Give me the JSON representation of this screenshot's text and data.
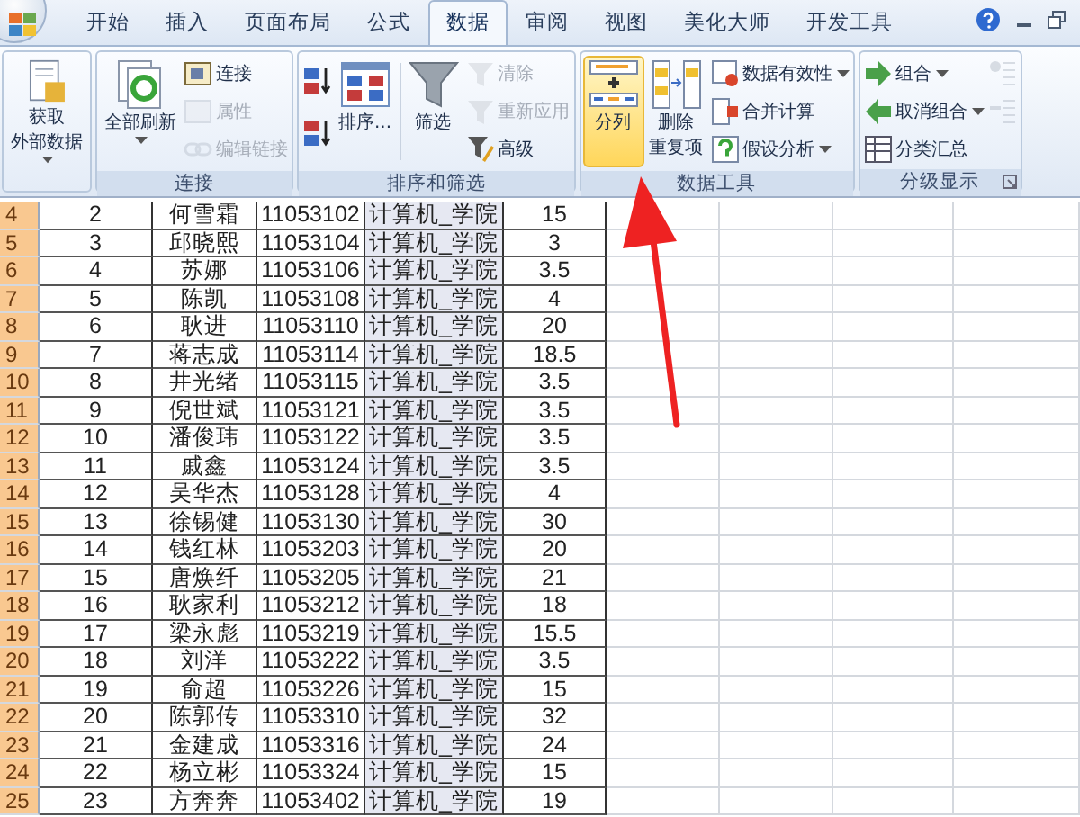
{
  "tabs": [
    {
      "label": "开始",
      "selected": false
    },
    {
      "label": "插入",
      "selected": false
    },
    {
      "label": "页面布局",
      "selected": false
    },
    {
      "label": "公式",
      "selected": false
    },
    {
      "label": "数据",
      "selected": true
    },
    {
      "label": "审阅",
      "selected": false
    },
    {
      "label": "视图",
      "selected": false
    },
    {
      "label": "美化大师",
      "selected": false
    },
    {
      "label": "开发工具",
      "selected": false
    }
  ],
  "ribbon": {
    "groups": [
      {
        "items": [
          {
            "kind": "large",
            "lines": [
              "获取",
              "外部数据"
            ],
            "dropdown": true,
            "disabled": false,
            "highlighted": false
          }
        ]
      },
      {
        "label": "连接",
        "items": [
          {
            "kind": "large",
            "lines": [
              "全部刷新"
            ],
            "dropdown": true,
            "disabled": false,
            "highlighted": false
          },
          {
            "kind": "small",
            "lines": [
              "连接"
            ],
            "dropdown": false,
            "disabled": false,
            "highlighted": false
          },
          {
            "kind": "small",
            "lines": [
              "属性"
            ],
            "dropdown": false,
            "disabled": true,
            "highlighted": false
          },
          {
            "kind": "small",
            "lines": [
              "编辑链接"
            ],
            "dropdown": false,
            "disabled": true,
            "highlighted": false
          }
        ]
      },
      {
        "label": "排序和筛选",
        "items": [
          {
            "kind": "icon",
            "dropdown": false,
            "disabled": false,
            "highlighted": false
          },
          {
            "kind": "icon",
            "dropdown": false,
            "disabled": false,
            "highlighted": false
          },
          {
            "kind": "large",
            "lines": [
              "排序..."
            ],
            "dropdown": false,
            "disabled": false,
            "highlighted": false
          },
          {
            "kind": "large",
            "lines": [
              "筛选"
            ],
            "dropdown": false,
            "disabled": false,
            "highlighted": false
          },
          {
            "kind": "small",
            "lines": [
              "清除"
            ],
            "dropdown": false,
            "disabled": true,
            "highlighted": false
          },
          {
            "kind": "small",
            "lines": [
              "重新应用"
            ],
            "dropdown": false,
            "disabled": true,
            "highlighted": false
          },
          {
            "kind": "small",
            "lines": [
              "高级"
            ],
            "dropdown": false,
            "disabled": false,
            "highlighted": false
          }
        ]
      },
      {
        "label": "数据工具",
        "items": [
          {
            "kind": "large",
            "lines": [
              "分列"
            ],
            "dropdown": false,
            "disabled": false,
            "highlighted": true
          },
          {
            "kind": "large",
            "lines": [
              "删除",
              "重复项"
            ],
            "dropdown": false,
            "disabled": false,
            "highlighted": false
          },
          {
            "kind": "small",
            "lines": [
              "数据有效性"
            ],
            "dropdown": true,
            "disabled": false,
            "highlighted": false
          },
          {
            "kind": "small",
            "lines": [
              "合并计算"
            ],
            "dropdown": false,
            "disabled": false,
            "highlighted": false
          },
          {
            "kind": "small",
            "lines": [
              "假设分析"
            ],
            "dropdown": true,
            "disabled": false,
            "highlighted": false
          }
        ]
      },
      {
        "label": "分级显示",
        "items": [
          {
            "kind": "small",
            "lines": [
              "组合"
            ],
            "dropdown": true,
            "disabled": false,
            "highlighted": false
          },
          {
            "kind": "small",
            "lines": [
              "取消组合"
            ],
            "dropdown": true,
            "disabled": false,
            "highlighted": false
          },
          {
            "kind": "small",
            "lines": [
              "分类汇总"
            ],
            "dropdown": false,
            "disabled": false,
            "highlighted": false
          },
          {
            "kind": "icon",
            "dropdown": false,
            "disabled": true,
            "highlighted": false
          },
          {
            "kind": "icon",
            "dropdown": false,
            "disabled": true,
            "highlighted": false
          }
        ]
      }
    ]
  },
  "table": {
    "columns": [
      {
        "shaded": false
      },
      {
        "shaded": false
      },
      {
        "shaded": false
      },
      {
        "shaded": true
      },
      {
        "shaded": false
      }
    ],
    "rows": [
      {
        "header": "4",
        "selected": true,
        "cells": [
          "2",
          "何雪霜",
          "11053102",
          "计算机_学院",
          "15"
        ]
      },
      {
        "header": "5",
        "selected": true,
        "cells": [
          "3",
          "邱晓熙",
          "11053104",
          "计算机_学院",
          "3"
        ]
      },
      {
        "header": "6",
        "selected": true,
        "cells": [
          "4",
          "苏娜",
          "11053106",
          "计算机_学院",
          "3.5"
        ]
      },
      {
        "header": "7",
        "selected": true,
        "cells": [
          "5",
          "陈凯",
          "11053108",
          "计算机_学院",
          "4"
        ]
      },
      {
        "header": "8",
        "selected": true,
        "cells": [
          "6",
          "耿进",
          "11053110",
          "计算机_学院",
          "20"
        ]
      },
      {
        "header": "9",
        "selected": true,
        "cells": [
          "7",
          "蒋志成",
          "11053114",
          "计算机_学院",
          "18.5"
        ]
      },
      {
        "header": "10",
        "selected": true,
        "cells": [
          "8",
          "井光绪",
          "11053115",
          "计算机_学院",
          "3.5"
        ]
      },
      {
        "header": "11",
        "selected": true,
        "cells": [
          "9",
          "倪世斌",
          "11053121",
          "计算机_学院",
          "3.5"
        ]
      },
      {
        "header": "12",
        "selected": true,
        "cells": [
          "10",
          "潘俊玮",
          "11053122",
          "计算机_学院",
          "3.5"
        ]
      },
      {
        "header": "13",
        "selected": true,
        "cells": [
          "11",
          "戚鑫",
          "11053124",
          "计算机_学院",
          "3.5"
        ]
      },
      {
        "header": "14",
        "selected": true,
        "cells": [
          "12",
          "吴华杰",
          "11053128",
          "计算机_学院",
          "4"
        ]
      },
      {
        "header": "15",
        "selected": true,
        "cells": [
          "13",
          "徐锡健",
          "11053130",
          "计算机_学院",
          "30"
        ]
      },
      {
        "header": "16",
        "selected": true,
        "cells": [
          "14",
          "钱红林",
          "11053203",
          "计算机_学院",
          "20"
        ]
      },
      {
        "header": "17",
        "selected": true,
        "cells": [
          "15",
          "唐焕纤",
          "11053205",
          "计算机_学院",
          "21"
        ]
      },
      {
        "header": "18",
        "selected": true,
        "cells": [
          "16",
          "耿家利",
          "11053212",
          "计算机_学院",
          "18"
        ]
      },
      {
        "header": "19",
        "selected": true,
        "cells": [
          "17",
          "梁永彪",
          "11053219",
          "计算机_学院",
          "15.5"
        ]
      },
      {
        "header": "20",
        "selected": true,
        "cells": [
          "18",
          "刘洋",
          "11053222",
          "计算机_学院",
          "3.5"
        ]
      },
      {
        "header": "21",
        "selected": true,
        "cells": [
          "19",
          "俞超",
          "11053226",
          "计算机_学院",
          "15"
        ]
      },
      {
        "header": "22",
        "selected": true,
        "cells": [
          "20",
          "陈郭传",
          "11053310",
          "计算机_学院",
          "32"
        ]
      },
      {
        "header": "23",
        "selected": true,
        "cells": [
          "21",
          "金建成",
          "11053316",
          "计算机_学院",
          "24"
        ]
      },
      {
        "header": "24",
        "selected": true,
        "cells": [
          "22",
          "杨立彬",
          "11053324",
          "计算机_学院",
          "15"
        ]
      },
      {
        "header": "25",
        "selected": true,
        "cells": [
          "23",
          "方奔奔",
          "11053402",
          "计算机_学院",
          "19"
        ]
      }
    ]
  }
}
